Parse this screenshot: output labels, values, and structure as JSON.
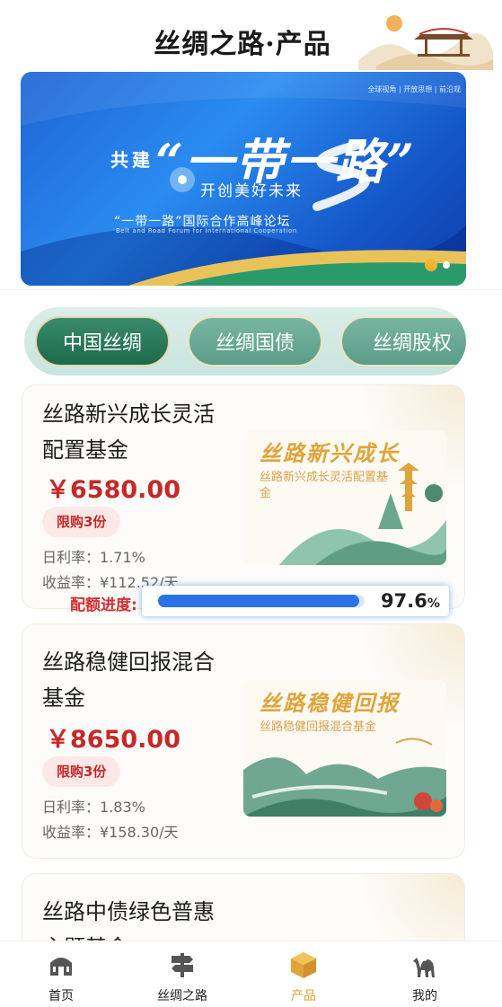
{
  "header": {
    "title": "丝绸之路·产品"
  },
  "banner": {
    "top_links": "全球视角 | 开放思想 | 前沿观",
    "gong_jian": "共建",
    "slogan": "“一带一路”",
    "sub_slogan": "开创美好未来",
    "forum_cn": "“一带一路”国际合作高峰论坛",
    "forum_en": "Belt and Road Forum for International Cooperation",
    "slide_count": 2,
    "active_slide": 1
  },
  "tabs": [
    {
      "label": "中国丝绸",
      "active": true
    },
    {
      "label": "丝绸国债",
      "active": false
    },
    {
      "label": "丝绸股权",
      "active": false
    }
  ],
  "products": [
    {
      "name": "丝路新兴成长灵活配置基金",
      "price": "￥6580.00",
      "limit": "限购3份",
      "daily_rate": "日利率：1.71%",
      "yield": "收益率：¥112.52/天",
      "art_title": "丝路新兴成长",
      "art_sub": "丝路新兴成长灵活配置基金"
    },
    {
      "name": "丝路稳健回报混合基金",
      "price": "￥8650.00",
      "limit": "限购3份",
      "daily_rate": "日利率：1.83%",
      "yield": "收益率：¥158.30/天",
      "art_title": "丝路稳健回报",
      "art_sub": "丝路稳健回报混合基金"
    },
    {
      "name": "丝路中债绿色普惠主题基金"
    }
  ],
  "quota": {
    "label": "配额进度:",
    "value": "97.6",
    "unit": "%",
    "fraction": 0.976
  },
  "bottom_nav": [
    {
      "label": "首页",
      "icon": "home-building-icon",
      "active": false
    },
    {
      "label": "丝绸之路",
      "icon": "signpost-icon",
      "active": false
    },
    {
      "label": "产品",
      "icon": "product-box-icon",
      "active": true
    },
    {
      "label": "我的",
      "icon": "camel-icon",
      "active": false
    }
  ],
  "colors": {
    "accent": "#d4a432",
    "price": "#c62828",
    "progress": "#2b73e6",
    "tab_active": "#1d6a4c"
  }
}
